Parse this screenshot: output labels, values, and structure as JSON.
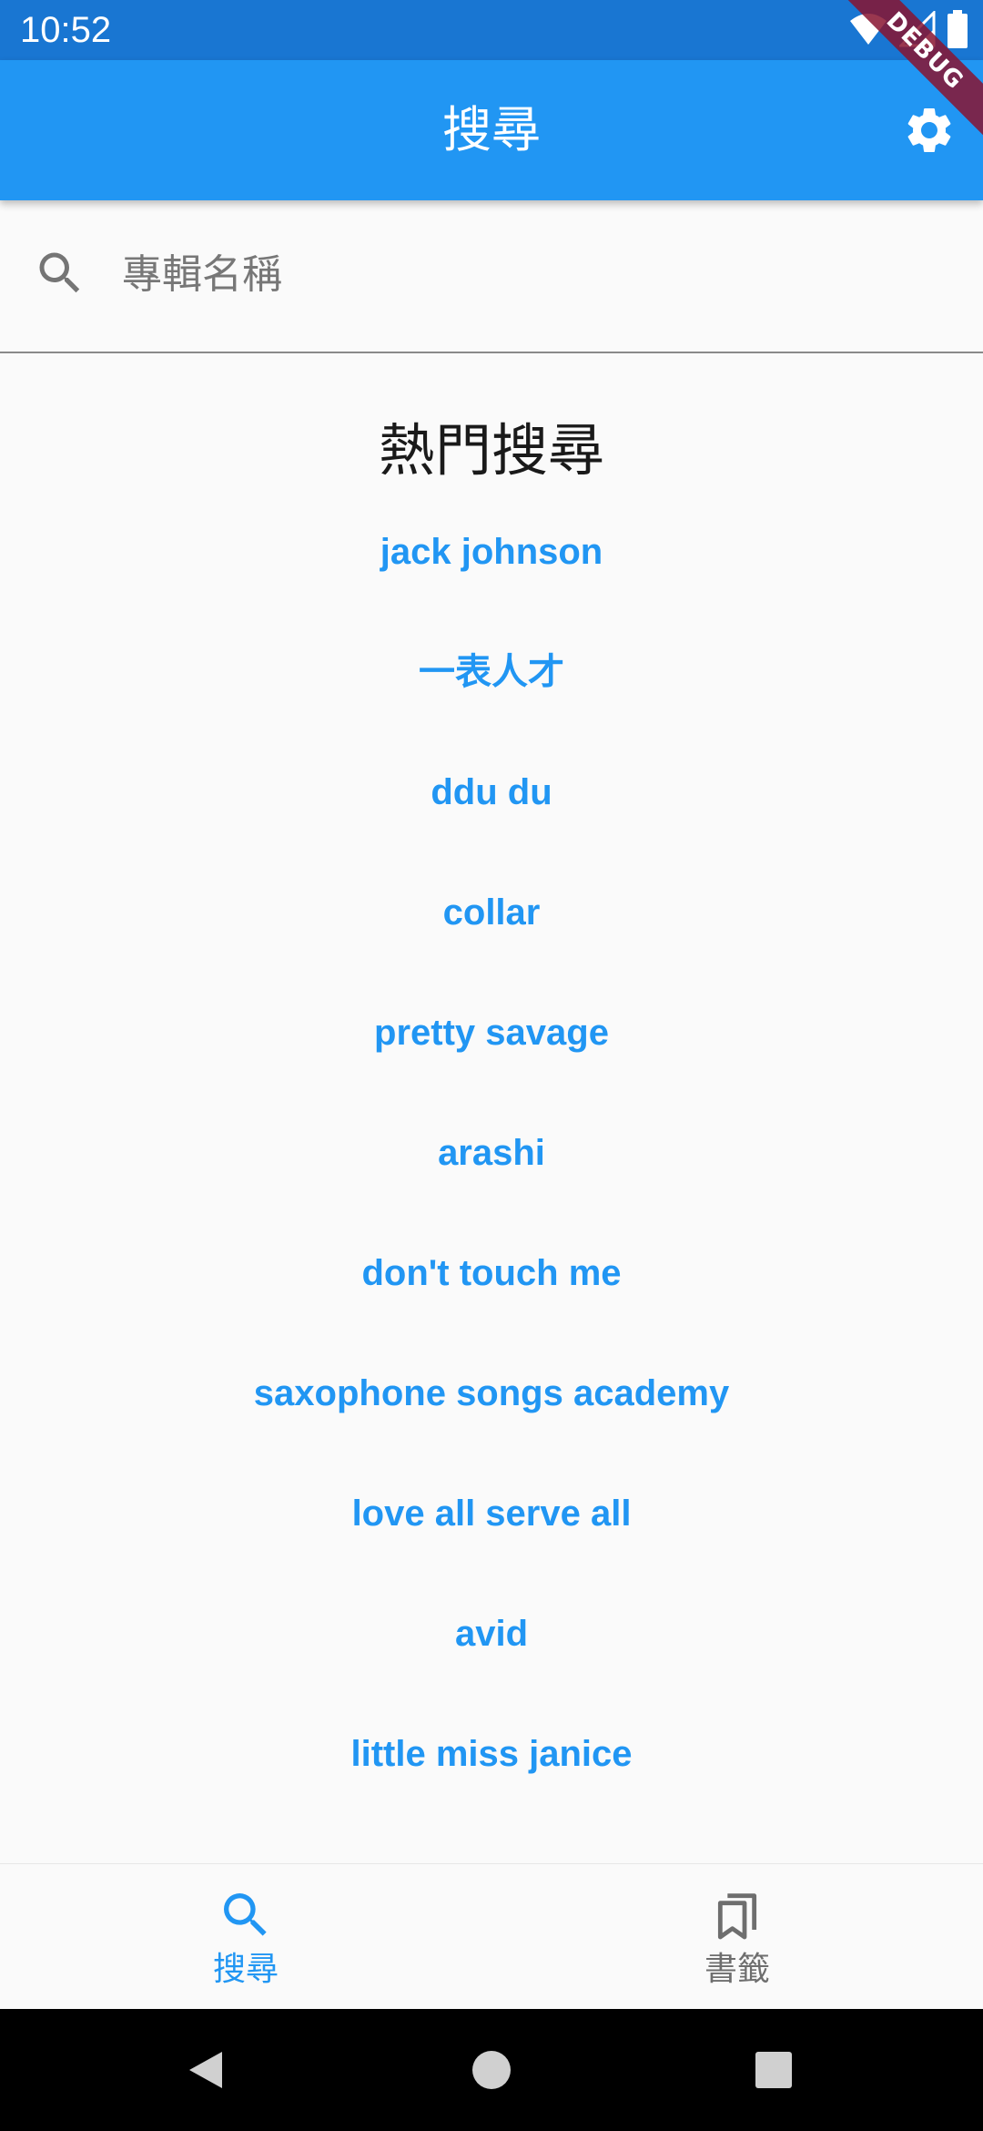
{
  "status_bar": {
    "time": "10:52",
    "icons": [
      "wifi-icon",
      "cell-signal-icon",
      "battery-icon"
    ]
  },
  "debug_banner": "DEBUG",
  "app_bar": {
    "title": "搜尋",
    "settings_icon": "gear-icon"
  },
  "search": {
    "placeholder": "專輯名稱",
    "value": "",
    "icon": "search-icon"
  },
  "hot": {
    "title": "熱門搜尋",
    "items": [
      "jack johnson",
      "一表人才",
      "ddu du",
      "collar",
      "pretty savage",
      "arashi",
      "don't touch me",
      "saxophone songs academy",
      "love all serve all",
      "avid",
      "little miss janice"
    ]
  },
  "bottom_nav": {
    "items": [
      {
        "label": "搜尋",
        "icon": "search-icon",
        "active": true
      },
      {
        "label": "書籤",
        "icon": "bookmarks-icon",
        "active": false
      }
    ]
  },
  "system_nav": [
    "back-icon",
    "home-icon",
    "recents-icon"
  ],
  "colors": {
    "primary": "#2196f3",
    "status_bar": "#1976d2",
    "background": "#fafafa",
    "inactive": "#6e6e6e"
  }
}
